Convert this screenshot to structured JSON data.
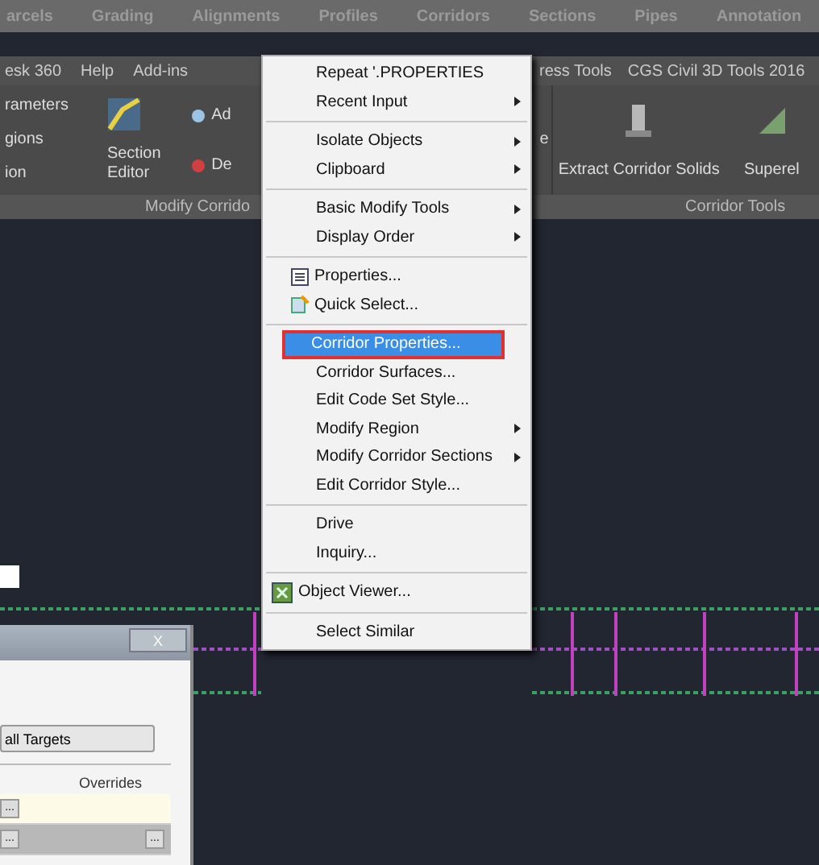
{
  "tabs": [
    "arcels",
    "Grading",
    "Alignments",
    "Profiles",
    "Corridors",
    "Sections",
    "Pipes",
    "Annotation"
  ],
  "menu_bar": [
    "esk 360",
    "Help",
    "Add-ins",
    "ress Tools",
    "CGS Civil 3D Tools 2016"
  ],
  "ribbon": {
    "left_items": [
      "rameters",
      "gions",
      "ion"
    ],
    "section_editor": "Section Editor",
    "small_items": [
      "Ad",
      "De"
    ],
    "cut_item": "e",
    "extract": "Extract Corridor Solids",
    "superel": "Superel",
    "panels": [
      "Modify Corrido",
      "Corridor Tools"
    ]
  },
  "context_menu": [
    {
      "kind": "item",
      "label": "Repeat '.PROPERTIES",
      "submenu": false,
      "selected": false
    },
    {
      "kind": "item",
      "label": "Recent Input",
      "submenu": true,
      "selected": false
    },
    {
      "kind": "separator"
    },
    {
      "kind": "item",
      "label": "Isolate Objects",
      "submenu": true,
      "selected": false
    },
    {
      "kind": "item",
      "label": "Clipboard",
      "submenu": true,
      "selected": false
    },
    {
      "kind": "separator"
    },
    {
      "kind": "item",
      "label": "Basic Modify Tools",
      "submenu": true,
      "selected": false
    },
    {
      "kind": "item",
      "label": "Display Order",
      "submenu": true,
      "selected": false
    },
    {
      "kind": "separator"
    },
    {
      "kind": "properties",
      "label": "Properties...",
      "submenu": false,
      "selected": false
    },
    {
      "kind": "quickselect",
      "label": "Quick Select...",
      "submenu": false,
      "selected": false
    },
    {
      "kind": "separator"
    },
    {
      "kind": "item",
      "label": "Corridor Properties...",
      "submenu": false,
      "selected": true
    },
    {
      "kind": "item",
      "label": "Corridor Surfaces...",
      "submenu": false,
      "selected": false
    },
    {
      "kind": "item",
      "label": "Edit Code Set Style...",
      "submenu": false,
      "selected": false
    },
    {
      "kind": "item",
      "label": "Modify Region",
      "submenu": true,
      "selected": false
    },
    {
      "kind": "item",
      "label": "Modify Corridor Sections",
      "submenu": true,
      "selected": false
    },
    {
      "kind": "item",
      "label": "Edit Corridor Style...",
      "submenu": false,
      "selected": false
    },
    {
      "kind": "separator"
    },
    {
      "kind": "item",
      "label": "Drive",
      "submenu": false,
      "selected": false
    },
    {
      "kind": "item",
      "label": "Inquiry...",
      "submenu": false,
      "selected": false
    },
    {
      "kind": "separator"
    },
    {
      "kind": "viewer",
      "label": "Object Viewer...",
      "submenu": false,
      "selected": false
    },
    {
      "kind": "separator"
    },
    {
      "kind": "item",
      "label": "Select Similar",
      "submenu": false,
      "selected": false
    }
  ],
  "dialog": {
    "close": "X",
    "button": "all Targets",
    "column": "Overrides",
    "rows": [
      {
        "selected": false,
        "buttons": [
          "..."
        ]
      },
      {
        "selected": true,
        "buttons": [
          "...",
          "..."
        ]
      }
    ]
  }
}
